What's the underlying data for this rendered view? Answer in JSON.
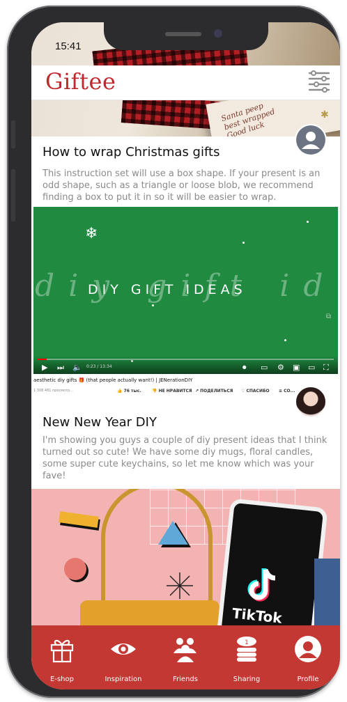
{
  "status_bar": {
    "time": "15:41"
  },
  "app": {
    "logo": "Giftee"
  },
  "header_image": {
    "handwriting": "Santa peep\nbest wrapped\nGood luck"
  },
  "posts": [
    {
      "title": "How to wrap Christmas gifts",
      "body": "This instruction set will use a box shape. If your present is an odd shape, such as a triangle or loose blob, we recommend finding a box to put it in so it will be easier to wrap."
    },
    {
      "title": "New New Year DIY",
      "body": "I'm showing you guys a couple of diy present ideas that I think turned out so cute! We have some diy mugs, floral candles, some super cute keychains, so let me know which was your fave!"
    }
  ],
  "video": {
    "overlay_title": "DIY GIFT IDEAS",
    "overlay_cursive": "diy gift ideas",
    "time": "0:23 / 13:34",
    "progress": 0.03,
    "youtube_title": "aesthetic diy gifts 🎁 (that people actually want!) | JENerationDIY",
    "views": "1 308 481 просмотр...",
    "likes": "76 тыс.",
    "dislike": "НЕ НРАВИТСЯ",
    "share": "ПОДЕЛИТЬСЯ",
    "thanks": "СПАСИБО",
    "save": "СО..."
  },
  "promo": {
    "brand_text": "TikTok"
  },
  "nav": [
    {
      "label": "E-shop",
      "icon": "gift-icon"
    },
    {
      "label": "Inspiration",
      "icon": "eye-icon"
    },
    {
      "label": "Friends",
      "icon": "friends-icon"
    },
    {
      "label": "Sharing",
      "icon": "coins-icon"
    },
    {
      "label": "Profile",
      "icon": "profile-icon"
    }
  ],
  "colors": {
    "brand": "#c0282d",
    "nav_bg": "#c43834",
    "video_bg": "#1f8a40"
  }
}
